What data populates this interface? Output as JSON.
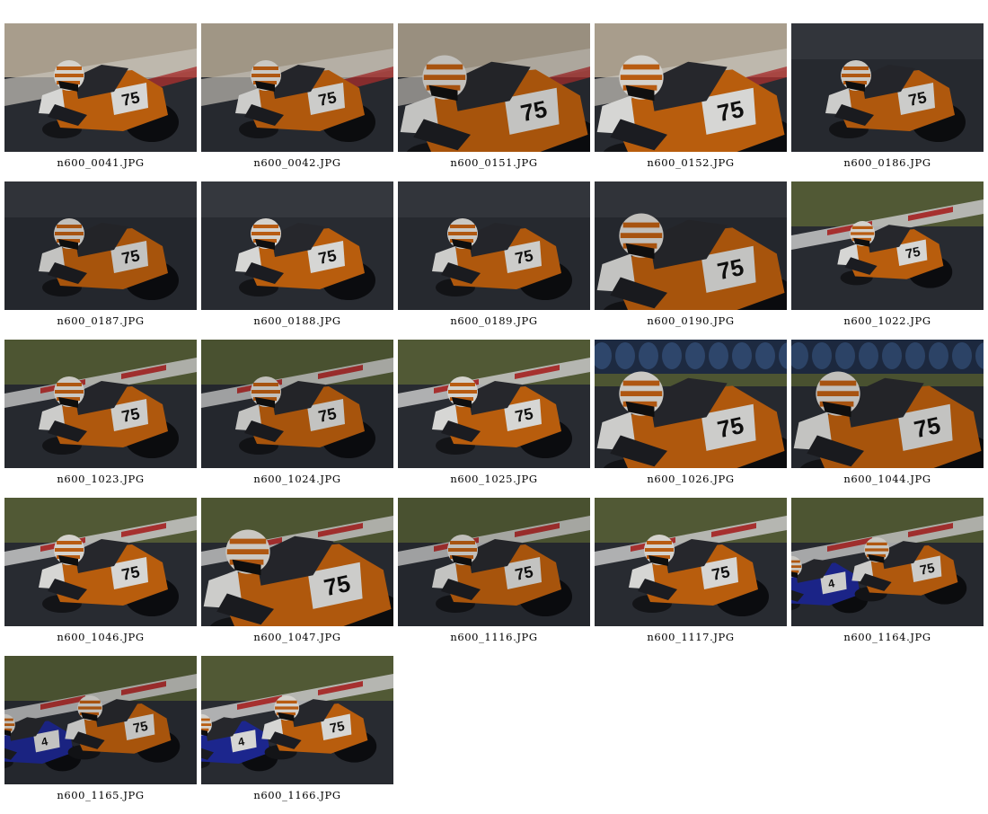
{
  "gallery": {
    "thumbnails": [
      {
        "filename": "n600_0041.JPG",
        "background": "sand",
        "rider_number": "75",
        "zoom": "mid"
      },
      {
        "filename": "n600_0042.JPG",
        "background": "sand",
        "rider_number": "75",
        "zoom": "mid"
      },
      {
        "filename": "n600_0151.JPG",
        "background": "sand",
        "rider_number": "75",
        "zoom": "close"
      },
      {
        "filename": "n600_0152.JPG",
        "background": "sand",
        "rider_number": "75",
        "zoom": "close"
      },
      {
        "filename": "n600_0186.JPG",
        "background": "dark",
        "rider_number": "75",
        "zoom": "mid"
      },
      {
        "filename": "n600_0187.JPG",
        "background": "dark",
        "rider_number": "75",
        "zoom": "mid"
      },
      {
        "filename": "n600_0188.JPG",
        "background": "dark",
        "rider_number": "75",
        "zoom": "mid"
      },
      {
        "filename": "n600_0189.JPG",
        "background": "dark",
        "rider_number": "75",
        "zoom": "mid"
      },
      {
        "filename": "n600_0190.JPG",
        "background": "dark",
        "rider_number": "75",
        "zoom": "close"
      },
      {
        "filename": "n600_1022.JPG",
        "background": "grass",
        "rider_number": "75",
        "zoom": "far"
      },
      {
        "filename": "n600_1023.JPG",
        "background": "grass",
        "rider_number": "75",
        "zoom": "mid"
      },
      {
        "filename": "n600_1024.JPG",
        "background": "grass",
        "rider_number": "75",
        "zoom": "mid"
      },
      {
        "filename": "n600_1025.JPG",
        "background": "grass",
        "rider_number": "75",
        "zoom": "mid"
      },
      {
        "filename": "n600_1026.JPG",
        "background": "tires",
        "rider_number": "75",
        "zoom": "close"
      },
      {
        "filename": "n600_1044.JPG",
        "background": "tires",
        "rider_number": "75",
        "zoom": "close"
      },
      {
        "filename": "n600_1046.JPG",
        "background": "grass",
        "rider_number": "75",
        "zoom": "mid"
      },
      {
        "filename": "n600_1047.JPG",
        "background": "grass",
        "rider_number": "75",
        "zoom": "close"
      },
      {
        "filename": "n600_1116.JPG",
        "background": "grass",
        "rider_number": "75",
        "zoom": "mid"
      },
      {
        "filename": "n600_1117.JPG",
        "background": "grass",
        "rider_number": "75",
        "zoom": "mid"
      },
      {
        "filename": "n600_1164.JPG",
        "background": "grass",
        "rider_number": "75",
        "zoom": "far",
        "second_bike": true
      },
      {
        "filename": "n600_1165.JPG",
        "background": "grass",
        "rider_number": "75",
        "zoom": "far",
        "second_bike": true
      },
      {
        "filename": "n600_1166.JPG",
        "background": "grass",
        "rider_number": "75",
        "zoom": "far",
        "second_bike": true
      }
    ]
  },
  "colors": {
    "page_background": "#ffffff",
    "caption_text": "#000000",
    "bike_orange": "#c8650f",
    "bike_white": "#e9e9e6",
    "asphalt": "#2c2f36",
    "grass": "#58613a",
    "sand": "#b7ab98",
    "kerb_red": "#b53534",
    "second_bike_blue": "#1f2a9a"
  }
}
